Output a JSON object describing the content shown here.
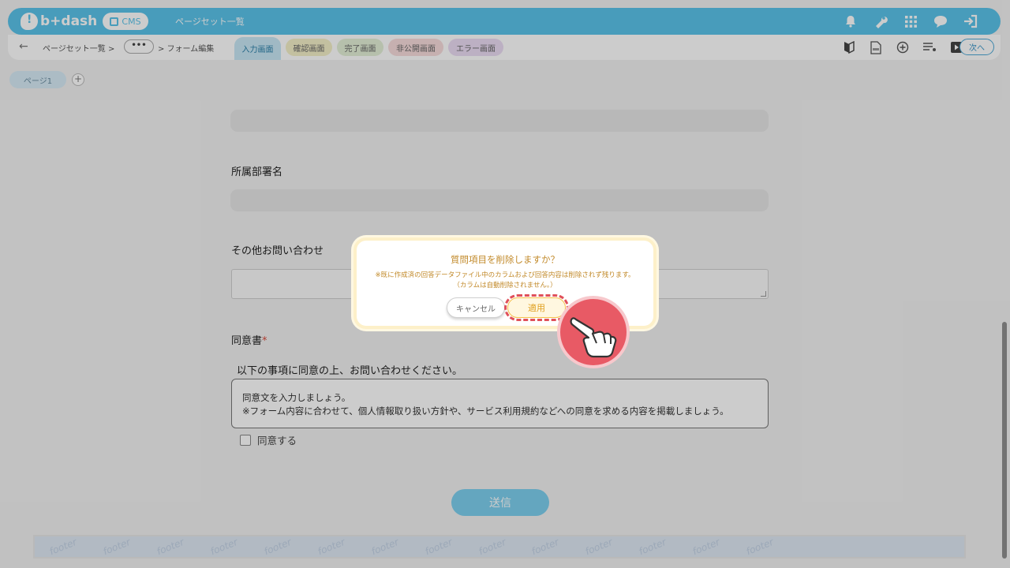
{
  "header": {
    "logo_text": "b+dash",
    "cms_label": "CMS",
    "page_title": "ページセット一覧",
    "icons": [
      "bell-icon",
      "wrench-icon",
      "apps-grid-icon",
      "chat-icon",
      "logout-icon"
    ]
  },
  "subbar": {
    "crumb_list": "ページセット一覧 >",
    "crumb_dots": "•••",
    "crumb_edit": "> フォーム編集",
    "tabs": [
      {
        "label": "入力画面",
        "color": "#c8e8f5"
      },
      {
        "label": "確認画面",
        "color": "#f4f0c8"
      },
      {
        "label": "完了画面",
        "color": "#e4f0d8"
      },
      {
        "label": "非公開画面",
        "color": "#f8dcdc"
      },
      {
        "label": "エラー画面",
        "color": "#ecdcf4"
      }
    ],
    "icons": [
      "beginner-mark-icon",
      "html-file-icon",
      "add-circle-icon",
      "list-icon",
      "play-icon"
    ],
    "next_label": "次へ"
  },
  "page": {
    "pill_label": "ページ1",
    "add_label": "+"
  },
  "form": {
    "dept_label": "所属部署名",
    "other_label": "その他お問い合わせ",
    "consent_label": "同意書",
    "required_mark": "*",
    "consent_title": "以下の事項に同意の上、お問い合わせください。",
    "consent_text_1": "同意文を入力しましょう。",
    "consent_text_2": "※フォーム内容に合わせて、個人情報取り扱い方針や、サービス利用規約などへの同意を求める内容を掲載しましょう。",
    "consent_check_label": "同意する",
    "submit_label": "送信",
    "footer_word": "footer"
  },
  "dialog": {
    "title": "質問項目を削除しますか？",
    "message_1": "※既に作成済の回答データファイル中のカラムおよび回答内容は削除されず残ります。",
    "message_2": "（カラムは自動削除されません。）",
    "cancel_label": "キャンセル",
    "apply_label": "適用"
  },
  "colors": {
    "brand": "#5bc4ea",
    "dialog_text": "#c28a2a",
    "highlight": "#e0505a"
  }
}
